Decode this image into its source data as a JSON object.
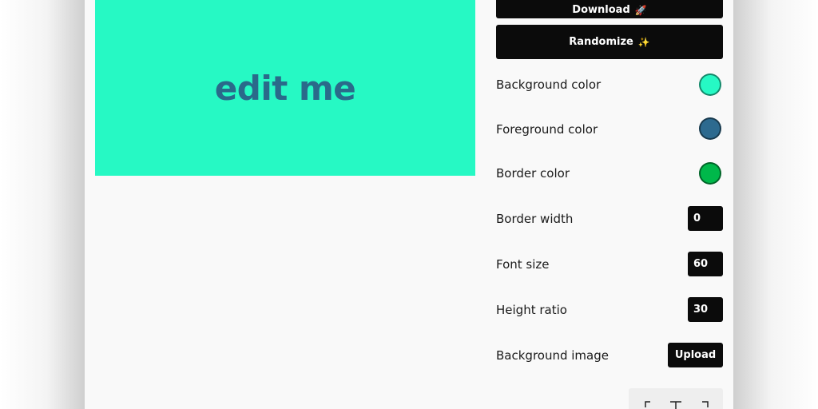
{
  "preview": {
    "text": "edit me",
    "background_color": "#26F9C4",
    "text_color": "#2A6A8A"
  },
  "buttons": {
    "download_label": "Download",
    "download_emoji": "🚀",
    "randomize_label": "Randomize",
    "randomize_emoji": "✨"
  },
  "settings": {
    "background_color": {
      "label": "Background color",
      "value": "#26F9C4"
    },
    "foreground_color": {
      "label": "Foreground color",
      "value": "#2D6A8F"
    },
    "border_color": {
      "label": "Border color",
      "value": "#00B84A"
    },
    "border_width": {
      "label": "Border width",
      "value": "0"
    },
    "font_size": {
      "label": "Font size",
      "value": "60"
    },
    "height_ratio": {
      "label": "Height ratio",
      "value": "30"
    },
    "background_image": {
      "label": "Background image",
      "button_label": "Upload"
    }
  },
  "icons": {
    "align_panel": [
      "align-left-icon",
      "align-center-icon",
      "align-right-icon"
    ]
  }
}
